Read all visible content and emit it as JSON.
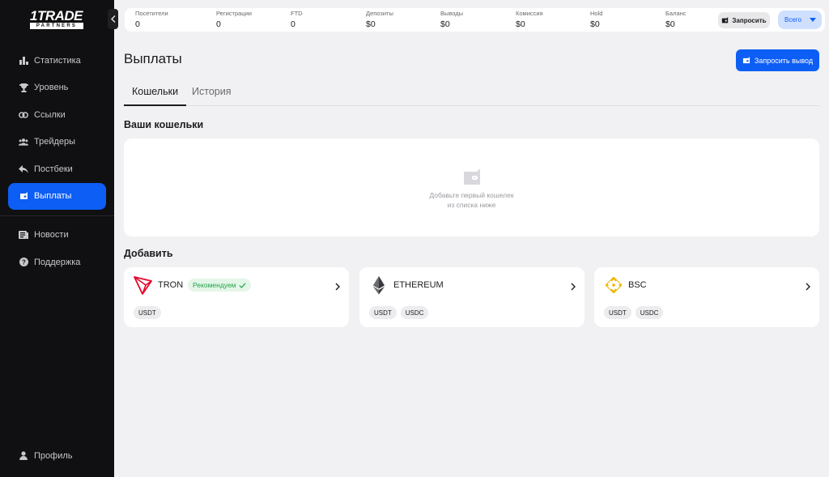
{
  "brand": {
    "logo_top": "1TRADE",
    "logo_bottom": "PARTNERS"
  },
  "sidebar": {
    "items": [
      {
        "label": "Статистика",
        "icon": "bar-chart-icon"
      },
      {
        "label": "Уровень",
        "icon": "trophy-icon"
      },
      {
        "label": "Ссылки",
        "icon": "link-icon"
      },
      {
        "label": "Трейдеры",
        "icon": "users-icon"
      },
      {
        "label": "Постбеки",
        "icon": "reply-icon"
      },
      {
        "label": "Выплаты",
        "icon": "wallet-icon",
        "active": true
      }
    ],
    "secondary": [
      {
        "label": "Новости",
        "icon": "news-icon"
      },
      {
        "label": "Поддержка",
        "icon": "help-icon"
      }
    ],
    "profile": {
      "label": "Профиль",
      "icon": "user-icon"
    }
  },
  "stats": [
    {
      "label": "Посетители",
      "value": "0"
    },
    {
      "label": "Регистрации",
      "value": "0"
    },
    {
      "label": "FTD",
      "value": "0"
    },
    {
      "label": "Депозиты",
      "value": "$0"
    },
    {
      "label": "Выводы",
      "value": "$0"
    },
    {
      "label": "Комиссия",
      "value": "$0"
    },
    {
      "label": "Hold",
      "value": "$0"
    },
    {
      "label": "Баланс",
      "value": "$0"
    }
  ],
  "topbar": {
    "request_label": "Запросить",
    "period_label": "Всего"
  },
  "page": {
    "title": "Выплаты",
    "withdraw_button": "Запросить вывод"
  },
  "tabs": [
    {
      "label": "Кошельки",
      "active": true
    },
    {
      "label": "История"
    }
  ],
  "wallets": {
    "section_title": "Ваши кошельки",
    "empty_line1": "Добавьте первый кошелек",
    "empty_line2": "из списка ниже"
  },
  "add": {
    "section_title": "Добавить",
    "networks": [
      {
        "name": "TRON",
        "badge": "Рекомендуем",
        "icon": "tron-icon",
        "coins": [
          "USDT"
        ]
      },
      {
        "name": "ETHEREUM",
        "icon": "ethereum-icon",
        "coins": [
          "USDT",
          "USDC"
        ]
      },
      {
        "name": "BSC",
        "icon": "bnb-icon",
        "coins": [
          "USDT",
          "USDC"
        ]
      }
    ]
  },
  "colors": {
    "accent": "#0d5ef5",
    "sidebar_bg": "#101012",
    "page_bg": "#f1f1f3",
    "success": "#22a34a",
    "tron": "#e5062b",
    "bnb": "#f0b90b"
  }
}
